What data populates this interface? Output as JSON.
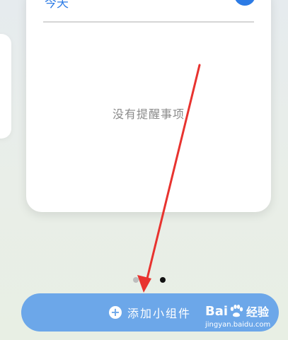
{
  "widget": {
    "header_label": "今天",
    "empty_text": "没有提醒事项"
  },
  "pagination": {
    "count": 2,
    "active_index": 1
  },
  "add_button": {
    "label": "添加小组件"
  },
  "watermark": {
    "logo_text_left": "Bai",
    "logo_text_right": "经验",
    "url": "jingyan.baidu.com"
  },
  "colors": {
    "accent_blue": "#2c7be5",
    "button_blue": "#6ca7e9",
    "annotation_red": "#e8332f"
  }
}
